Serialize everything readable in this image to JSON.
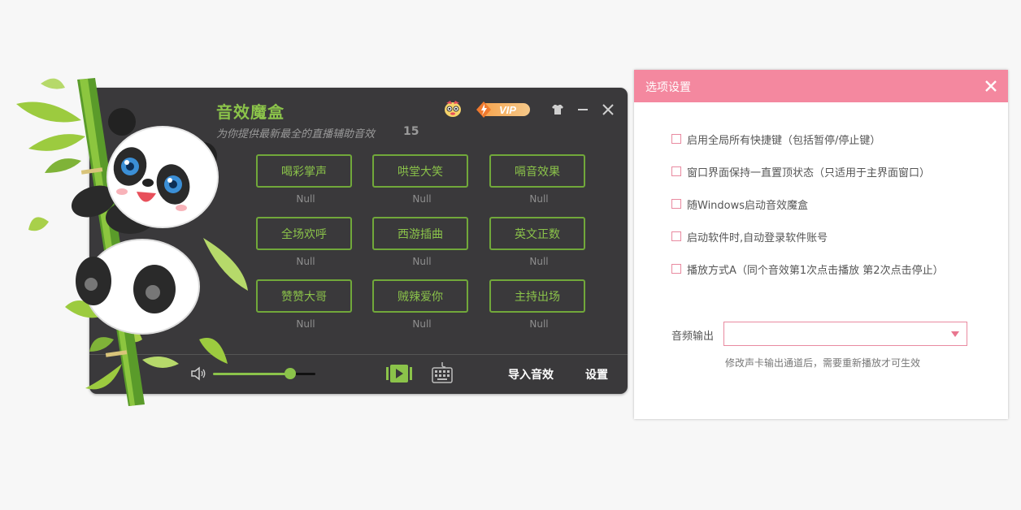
{
  "app": {
    "title": "音效魔盒",
    "subtitle": "为你提供最新最全的直播辅助音效",
    "count": "15",
    "vip_label": "VIP",
    "sounds": [
      {
        "label": "喝彩掌声",
        "status": "Null"
      },
      {
        "label": "哄堂大笑",
        "status": "Null"
      },
      {
        "label": "嗝音效果",
        "status": "Null"
      },
      {
        "label": "全场欢呼",
        "status": "Null"
      },
      {
        "label": "西游插曲",
        "status": "Null"
      },
      {
        "label": "英文正数",
        "status": "Null"
      },
      {
        "label": "赞赞大哥",
        "status": "Null"
      },
      {
        "label": "贼辣爱你",
        "status": "Null"
      },
      {
        "label": "主持出场",
        "status": "Null"
      }
    ],
    "volume": 0.75,
    "import_label": "导入音效",
    "settings_label": "设置",
    "icons": [
      "mascot-icon",
      "vip-badge",
      "skin-icon",
      "minimize-icon",
      "close-icon",
      "volume-icon",
      "video-icon",
      "keyboard-icon"
    ]
  },
  "dialog": {
    "title": "选项设置",
    "options": [
      {
        "label": "启用全局所有快捷键（包括暂停/停止键）",
        "checked": false
      },
      {
        "label": "窗口界面保持一直置顶状态（只适用于主界面窗口）",
        "checked": false
      },
      {
        "label": "随Windows启动音效魔盒",
        "checked": false
      },
      {
        "label": "启动软件时,自动登录软件账号",
        "checked": false
      },
      {
        "label": "播放方式A（同个音效第1次点击播放 第2次点击停止）",
        "checked": false
      }
    ],
    "audio_output_label": "音频输出",
    "audio_output_value": "",
    "audio_output_hint": "修改声卡输出通道后，需要重新播放才可生效"
  },
  "colors": {
    "accent_green": "#8bc34a",
    "window_bg": "#3a393b",
    "dialog_header": "#f4889f",
    "checkbox_border": "#e98aa0"
  }
}
